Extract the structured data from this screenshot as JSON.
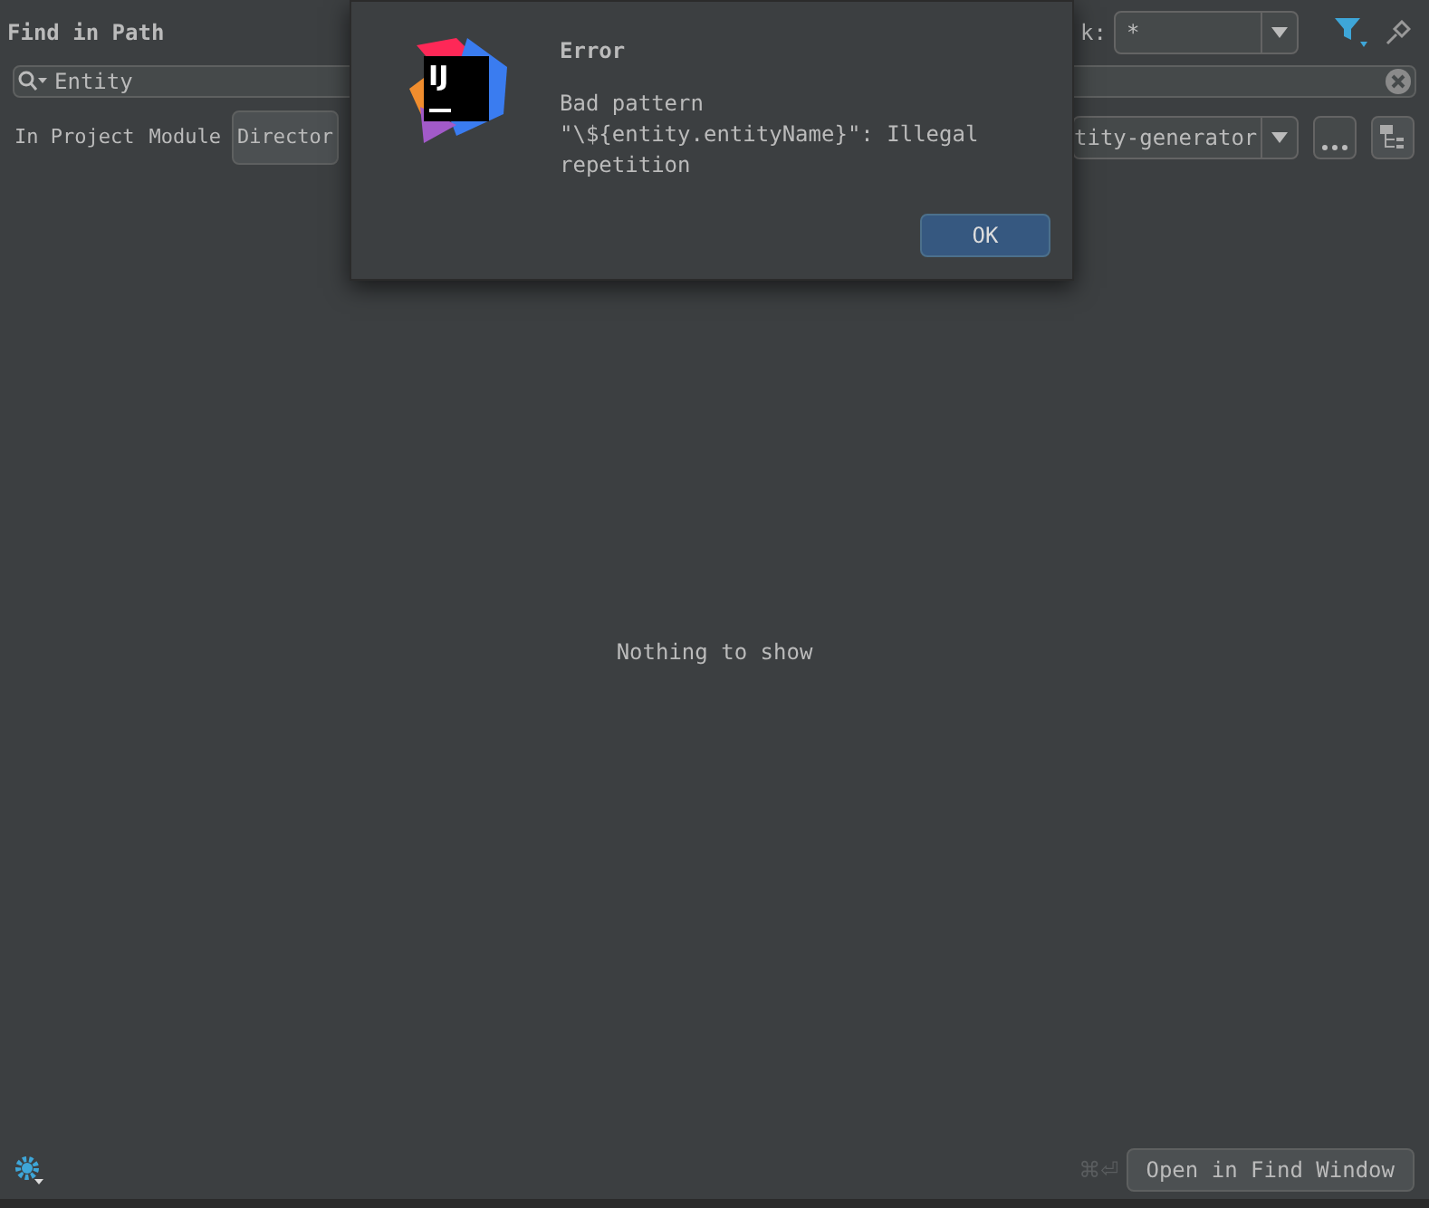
{
  "window": {
    "title": "Find in Path"
  },
  "file_mask": {
    "label": "k:",
    "value": "*"
  },
  "search": {
    "value": "Entity"
  },
  "scope": {
    "options": [
      {
        "label": "In Project",
        "selected": false
      },
      {
        "label": "Module",
        "selected": false
      },
      {
        "label": "Director",
        "selected": true
      }
    ],
    "path": "tity-generator"
  },
  "results": {
    "empty_text": "Nothing to show"
  },
  "footer": {
    "shortcut": "⌘⏎",
    "button": "Open in Find Window"
  },
  "dialog": {
    "title": "Error",
    "message": "Bad pattern \"\\${entity.entityName}\": Illegal repetition",
    "logo": "IJ",
    "buttons": [
      {
        "label": "OK",
        "selected": true
      }
    ]
  }
}
